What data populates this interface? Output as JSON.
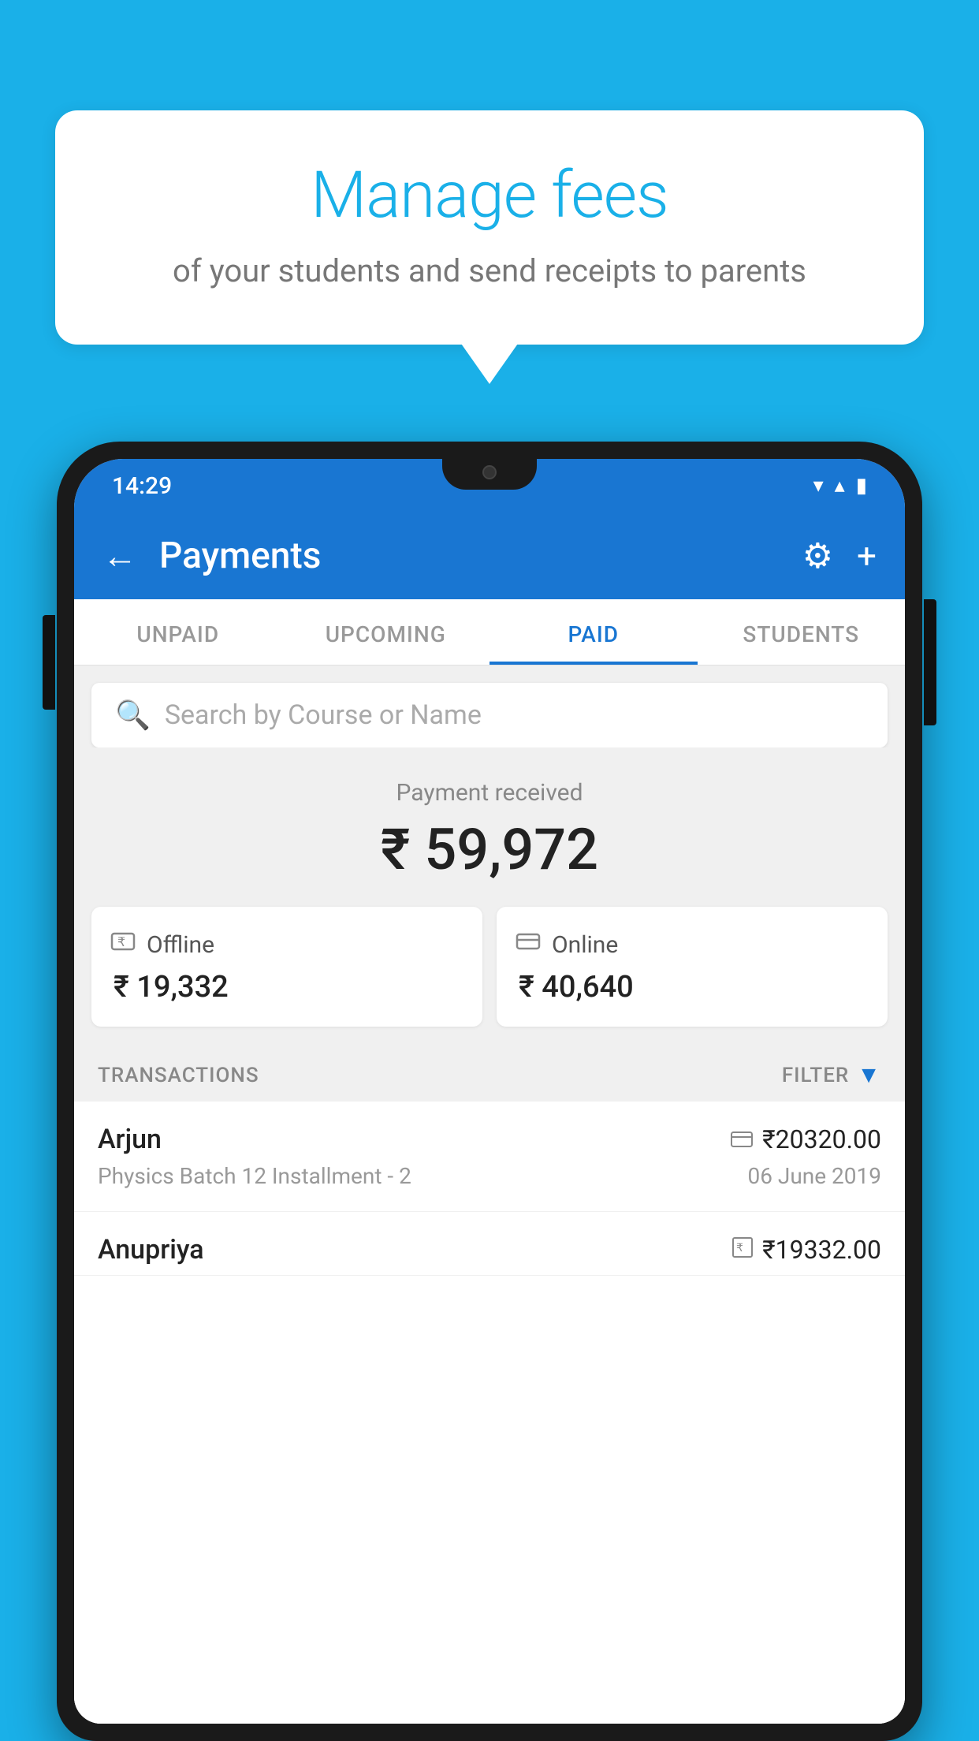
{
  "background_color": "#1ab0e8",
  "speech_bubble": {
    "title": "Manage fees",
    "subtitle": "of your students and send receipts to parents"
  },
  "status_bar": {
    "time": "14:29",
    "wifi": "▼",
    "signal": "▲",
    "battery": "▮"
  },
  "app_bar": {
    "back_label": "←",
    "title": "Payments",
    "gear_label": "⚙",
    "plus_label": "+"
  },
  "tabs": [
    {
      "label": "UNPAID",
      "active": false
    },
    {
      "label": "UPCOMING",
      "active": false
    },
    {
      "label": "PAID",
      "active": true
    },
    {
      "label": "STUDENTS",
      "active": false
    }
  ],
  "search": {
    "placeholder": "Search by Course or Name"
  },
  "payment_received": {
    "label": "Payment received",
    "amount": "₹ 59,972"
  },
  "payment_cards": [
    {
      "type": "Offline",
      "amount": "₹ 19,332",
      "icon": "offline"
    },
    {
      "type": "Online",
      "amount": "₹ 40,640",
      "icon": "online"
    }
  ],
  "transactions_section": {
    "label": "TRANSACTIONS",
    "filter_label": "FILTER"
  },
  "transactions": [
    {
      "name": "Arjun",
      "course": "Physics Batch 12 Installment - 2",
      "amount": "₹20320.00",
      "date": "06 June 2019",
      "payment_type": "online"
    },
    {
      "name": "Anupriya",
      "course": "",
      "amount": "₹19332.00",
      "date": "",
      "payment_type": "offline"
    }
  ]
}
